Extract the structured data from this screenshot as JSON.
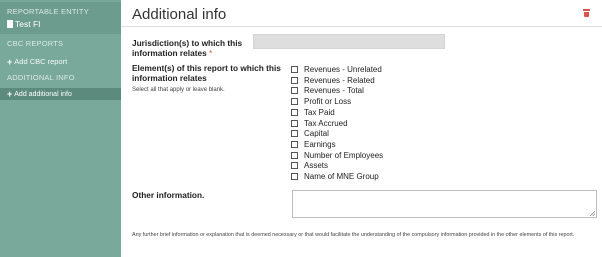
{
  "sidebar": {
    "reportable_entity_heading": "REPORTABLE ENTITY",
    "entity_name": "Test FI",
    "cbc_reports_heading": "CBC REPORTS",
    "add_cbc_report_label": "Add CBC report",
    "additional_info_heading": "ADDITIONAL INFO",
    "add_additional_info_label": "Add additional info"
  },
  "header": {
    "title": "Additional info",
    "delete_icon": "trash-icon",
    "delete_color": "#d9534f"
  },
  "form": {
    "jurisdiction_label_line1": "Jurisdiction(s) to which this",
    "jurisdiction_label_line2": "information relates",
    "required_marker": "*",
    "jurisdiction_value": "",
    "elements_label_line1": "Element(s) of this report to which this",
    "elements_label_line2": "information relates",
    "elements_hint": "Select all that apply or leave blank.",
    "elements_options": [
      {
        "label": "Revenues - Unrelated",
        "checked": false
      },
      {
        "label": "Revenues - Related",
        "checked": false
      },
      {
        "label": "Revenues - Total",
        "checked": false
      },
      {
        "label": "Profit or Loss",
        "checked": false
      },
      {
        "label": "Tax Paid",
        "checked": false
      },
      {
        "label": "Tax Accrued",
        "checked": false
      },
      {
        "label": "Capital",
        "checked": false
      },
      {
        "label": "Earnings",
        "checked": false
      },
      {
        "label": "Number of Employees",
        "checked": false
      },
      {
        "label": "Assets",
        "checked": false
      },
      {
        "label": "Name of MNE Group",
        "checked": false
      }
    ],
    "other_info_label": "Other information.",
    "other_info_value": "",
    "other_info_note": "Any further brief information or explanation that is deemed necessary or that would facilitate the understanding of the compulsory information provided in the other elements of this report."
  },
  "colors": {
    "sidebar_bg": "#78a99a",
    "sidebar_active_bg": "#5c8a7c"
  }
}
